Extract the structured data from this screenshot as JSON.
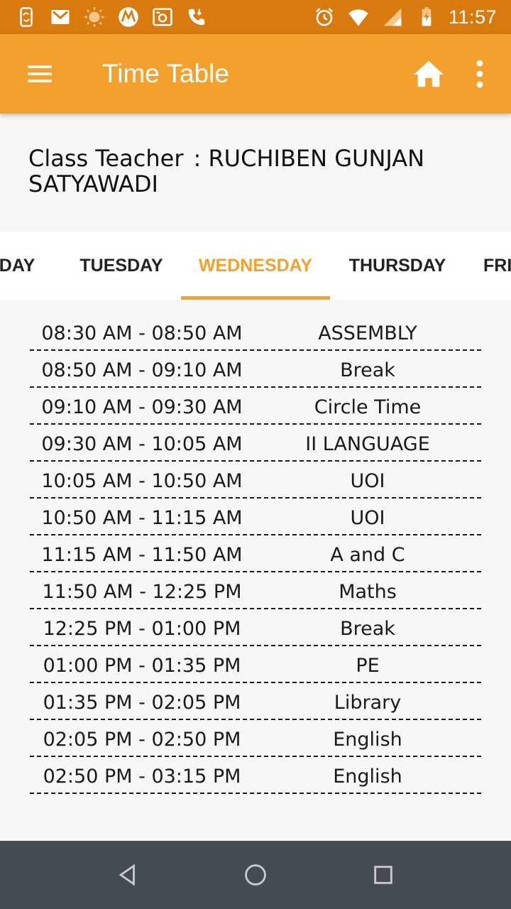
{
  "status_bar": {
    "time": "11:57",
    "left_icons": [
      "phone-sync-icon",
      "gmail-icon",
      "sun-icon",
      "motorola-icon",
      "camera-icon",
      "phone-call-icon"
    ],
    "right_icons": [
      "alarm-icon",
      "wifi-icon",
      "signal-icon",
      "battery-icon"
    ]
  },
  "app_bar": {
    "title": "Time Table",
    "menu_icon": "hamburger-menu-icon",
    "home_icon": "home-icon",
    "more_icon": "more-vert-icon"
  },
  "teacher": {
    "label": "Class Teacher",
    "name": ": RUCHIBEN GUNJAN SATYAWADI"
  },
  "tabs": [
    {
      "label": "MONDAY",
      "shown": "NDAY",
      "active": false
    },
    {
      "label": "TUESDAY",
      "active": false
    },
    {
      "label": "WEDNESDAY",
      "active": true
    },
    {
      "label": "THURSDAY",
      "active": false
    },
    {
      "label": "FRIDAY",
      "shown": "FRI",
      "active": false
    }
  ],
  "timetable": [
    {
      "time": "08:30 AM - 08:50 AM",
      "subject": "ASSEMBLY"
    },
    {
      "time": "08:50 AM - 09:10 AM",
      "subject": "Break"
    },
    {
      "time": "09:10 AM - 09:30 AM",
      "subject": "Circle Time"
    },
    {
      "time": "09:30 AM - 10:05 AM",
      "subject": "II LANGUAGE"
    },
    {
      "time": "10:05 AM - 10:50 AM",
      "subject": "UOI"
    },
    {
      "time": "10:50 AM - 11:15 AM",
      "subject": "UOI"
    },
    {
      "time": "11:15 AM - 11:50 AM",
      "subject": "A and C"
    },
    {
      "time": "11:50 AM - 12:25 PM",
      "subject": "Maths"
    },
    {
      "time": "12:25 PM - 01:00 PM",
      "subject": "Break"
    },
    {
      "time": "01:00 PM - 01:35 PM",
      "subject": "PE"
    },
    {
      "time": "01:35 PM - 02:05 PM",
      "subject": "Library"
    },
    {
      "time": "02:05 PM - 02:50 PM",
      "subject": "English"
    },
    {
      "time": "02:50 PM - 03:15 PM",
      "subject": "English"
    }
  ],
  "nav_bar": {
    "icons": [
      "back-icon",
      "home-circle-icon",
      "recents-icon"
    ]
  },
  "colors": {
    "status_bar": "#d97a0f",
    "app_bar": "#f4a02c",
    "accent": "#f4a02c",
    "nav_bar": "#454b50"
  }
}
